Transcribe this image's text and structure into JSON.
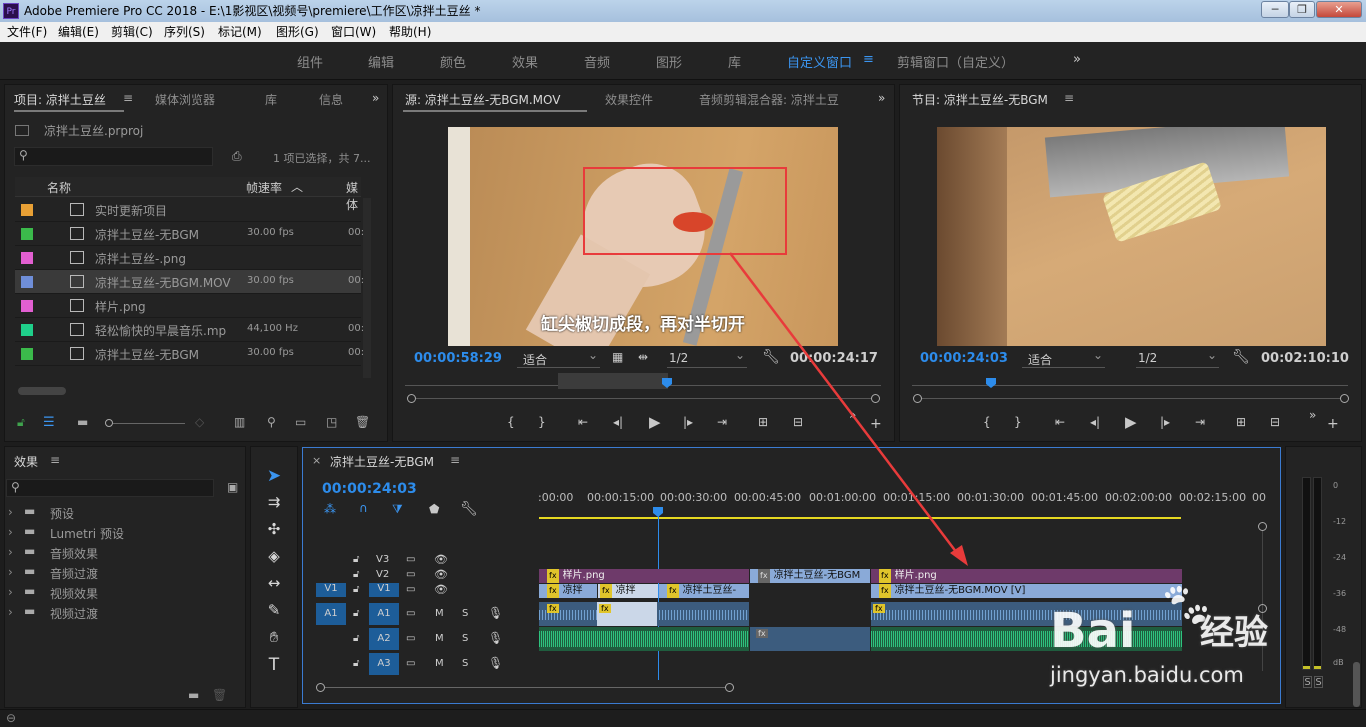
{
  "window": {
    "app_icon": "Pr",
    "title": "Adobe Premiere Pro CC 2018 - E:\\1影视区\\视频号\\premiere\\工作区\\凉拌土豆丝 *",
    "minimize": "─",
    "maximize": "❐",
    "close": "✕"
  },
  "menu": [
    "文件(F)",
    "编辑(E)",
    "剪辑(C)",
    "序列(S)",
    "标记(M)",
    "图形(G)",
    "窗口(W)",
    "帮助(H)"
  ],
  "workspaces": [
    "组件",
    "编辑",
    "颜色",
    "效果",
    "音频",
    "图形",
    "库",
    "自定义窗口",
    "剪辑窗口（自定义）"
  ],
  "workspace_menu_icon": "≡",
  "more_icon": "»",
  "project": {
    "tabs": [
      "项目: 凉拌土豆丝",
      "媒体浏览器",
      "库",
      "信息"
    ],
    "file": "凉拌土豆丝.prproj",
    "selection": "1 项已选择，共 7...",
    "col_name": "名称",
    "col_fps": "帧速率",
    "col_media": "媒体",
    "items": [
      {
        "name": "实时更新项目",
        "fps": "",
        "media": "",
        "color": "#e8a035",
        "icon": "bin"
      },
      {
        "name": "凉拌土豆丝-无BGM",
        "fps": "30.00 fps",
        "media": "00:",
        "color": "#3bba4b",
        "icon": "sequence"
      },
      {
        "name": "凉拌土豆丝-.png",
        "fps": "",
        "media": "",
        "color": "#e25fd1",
        "icon": "image"
      },
      {
        "name": "凉拌土豆丝-无BGM.MOV",
        "fps": "30.00 fps",
        "media": "00:",
        "color": "#6f8ed8",
        "icon": "video"
      },
      {
        "name": "样片.png",
        "fps": "",
        "media": "",
        "color": "#e25fd1",
        "icon": "image"
      },
      {
        "name": "轻松愉快的早晨音乐.mp",
        "fps": "44,100 Hz",
        "media": "00:",
        "color": "#1fcf8a",
        "icon": "audio"
      },
      {
        "name": "凉拌土豆丝-无BGM",
        "fps": "30.00 fps",
        "media": "00:",
        "color": "#3bba4b",
        "icon": "sequence"
      }
    ]
  },
  "source": {
    "tabs": [
      "源: 凉拌土豆丝-无BGM.MOV",
      "效果控件",
      "音频剪辑混合器: 凉拌土豆"
    ],
    "caption": "缸尖椒切成段，再对半切开",
    "timecode": "00:00:58:29",
    "fit": "适合",
    "quality": "1/2",
    "duration": "00:00:24:17"
  },
  "program": {
    "tabs": [
      "节目: 凉拌土豆丝-无BGM"
    ],
    "timecode": "00:00:24:03",
    "fit": "适合",
    "quality": "1/2",
    "duration": "00:02:10:10"
  },
  "effects": {
    "title": "效果",
    "items": [
      "预设",
      "Lumetri 预设",
      "音频效果",
      "音频过渡",
      "视频效果",
      "视频过渡"
    ]
  },
  "timeline": {
    "tab": "凉拌土豆丝-无BGM",
    "close": "×",
    "timecode": "00:00:24:03",
    "ruler": [
      ":00:00",
      "00:00:15:00",
      "00:00:30:00",
      "00:00:45:00",
      "00:01:00:00",
      "00:01:15:00",
      "00:01:30:00",
      "00:01:45:00",
      "00:02:00:00",
      "00:02:15:00",
      "00"
    ],
    "tracks": {
      "v3": "V3",
      "v2": "V2",
      "v1": "V1",
      "a1": "A1",
      "a2": "A2",
      "a3": "A3",
      "src_v1": "V1",
      "src_a1": "A1",
      "m": "M",
      "s": "S"
    },
    "clips": {
      "v2a": "样片.png",
      "v2b": "凉拌土豆丝-无BGM",
      "v2c": "样片.png",
      "v1a": "凉拌",
      "v1b": "凉拌",
      "v1c": "凉拌土豆丝-",
      "v1d": "凉拌土豆丝-无BGM.MOV [V]",
      "fx": "fx"
    }
  },
  "meter": {
    "labels": [
      "0",
      "-12",
      "-24",
      "-36",
      "-48",
      "dB"
    ],
    "solo": [
      "S",
      "S"
    ]
  },
  "watermark": {
    "brand": "Bai",
    "brand2": "经验",
    "url": "jingyan.baidu.com"
  },
  "colors": {
    "accent": "#2d8ceb",
    "annotation": "#e83b3b",
    "v2clip": "#6e3a6a",
    "v1clip": "#8aaad8",
    "audio": "#2ec27e"
  }
}
